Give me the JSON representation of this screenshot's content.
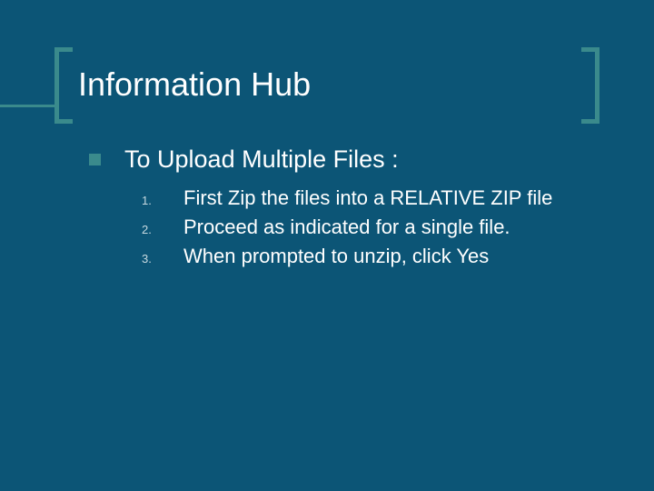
{
  "slide": {
    "title": "Information Hub",
    "subtitle": "To Upload Multiple Files :",
    "steps": [
      {
        "num": "1.",
        "text": "First Zip the files into a RELATIVE ZIP file"
      },
      {
        "num": "2.",
        "text": "Proceed as indicated for a single file."
      },
      {
        "num": "3.",
        "text": "When prompted to unzip, click Yes"
      }
    ]
  }
}
